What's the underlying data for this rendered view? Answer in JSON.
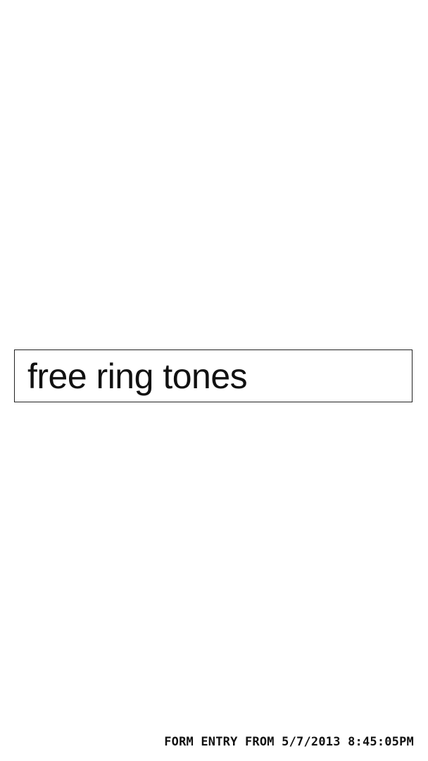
{
  "form": {
    "entry_value": "free ring tones"
  },
  "footer": {
    "caption": "FORM ENTRY FROM 5/7/2013 8:45:05PM"
  }
}
